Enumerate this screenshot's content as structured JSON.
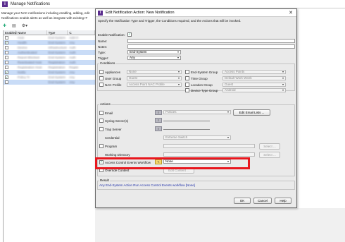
{
  "background": {
    "window_title": "Manage Notifications",
    "description": [
      "Manage your NAC notifications including enabling, adding, edit",
      "Notifications enable alerts as well as integrate with existing IT"
    ],
    "toolbar_icons": [
      "add-icon",
      "filter-icon",
      "settings-icon"
    ],
    "columns": [
      "Enabled",
      "Name",
      "Type",
      "C"
    ],
    "rows": [
      {
        "enabled": false,
        "name": "Host",
        "type": "End-System",
        "c": "Add-O",
        "sel": false
      },
      {
        "enabled": true,
        "name": "Health",
        "type": "End-System",
        "c": "Any",
        "sel": true
      },
      {
        "enabled": false,
        "name": "Device",
        "type": "Infrastructure",
        "c": "Auth",
        "sel": false
      },
      {
        "enabled": false,
        "name": "Authenticated",
        "type": "End-System",
        "c": "Auth",
        "sel": true
      },
      {
        "enabled": false,
        "name": "Report Blocked",
        "type": "End-System",
        "c": "Auth",
        "sel": false
      },
      {
        "enabled": false,
        "name": "Reactivated Host",
        "type": "Registration",
        "c": "Auth",
        "sel": true
      },
      {
        "enabled": false,
        "name": "Registration Host",
        "type": "Registration",
        "c": "Regist",
        "sel": false
      },
      {
        "enabled": true,
        "name": "Notify",
        "type": "End-System",
        "c": "Any",
        "sel": true
      },
      {
        "enabled": true,
        "name": "Policy Tr",
        "type": "End-System",
        "c": "Any",
        "sel": false
      },
      {
        "enabled": false,
        "name": "",
        "type": "End-System",
        "c": "Any",
        "sel": true
      }
    ]
  },
  "dialog": {
    "title": "Edit Notification Action: New Notification",
    "description": "Specify the Notification Type and Trigger, the Conditions required, and the Actions that will be invoked.",
    "enable_label": "Enable Notification:",
    "enable_checked": true,
    "name_label": "Name:",
    "name_value": "",
    "notes_label": "Notes:",
    "notes_value": "",
    "type_label": "Type:",
    "type_value": "End-System",
    "trigger_label": "Trigger:",
    "trigger_value": "Any",
    "conditions": {
      "legend": "Conditions",
      "appliances_label": "Appliances",
      "appliances_value": "None",
      "end_system_group_label": "End-System Group",
      "end_system_group_value": "Access Points",
      "user_group_label": "User Group",
      "user_group_value": "Guest",
      "time_group_label": "Time Group",
      "time_group_value": "Default Work Week",
      "nac_profile_label": "NAC Profile",
      "nac_profile_value": "Access Point NAC Profile",
      "location_group_label": "Location Group",
      "location_group_value": "Guest",
      "device_type_group_label": "Device Type Group",
      "device_type_group_value": "Android"
    },
    "actions": {
      "legend": "Actions",
      "email_label": "Email",
      "email_value": "Policies",
      "edit_email_lists": "Edit Email Lists ...",
      "syslog_label": "Syslog Server(s)",
      "trap_server_label": "Trap Server",
      "credential_label": "Credential",
      "credential_value": "Extreme Switch",
      "program_label": "Program",
      "select_label": "Select ...",
      "working_directory_label": "Working Directory",
      "select2_label": "Select ...",
      "ace_workflow_label": "Access Control Events Workflow",
      "ace_workflow_value": "None",
      "ace_workflow_checked": true,
      "override_label": "Override Content",
      "edit_content_label": "Edit Content ..."
    },
    "result": {
      "legend": "Result",
      "text": "Any End-System Action Run Access Control Events workflow [None]"
    },
    "ok": "OK",
    "cancel": "Cancel",
    "help": "Help"
  },
  "colors": {
    "highlight": "#e8171e",
    "result_text": "#2233aa",
    "selection": "#c9dcf7"
  }
}
